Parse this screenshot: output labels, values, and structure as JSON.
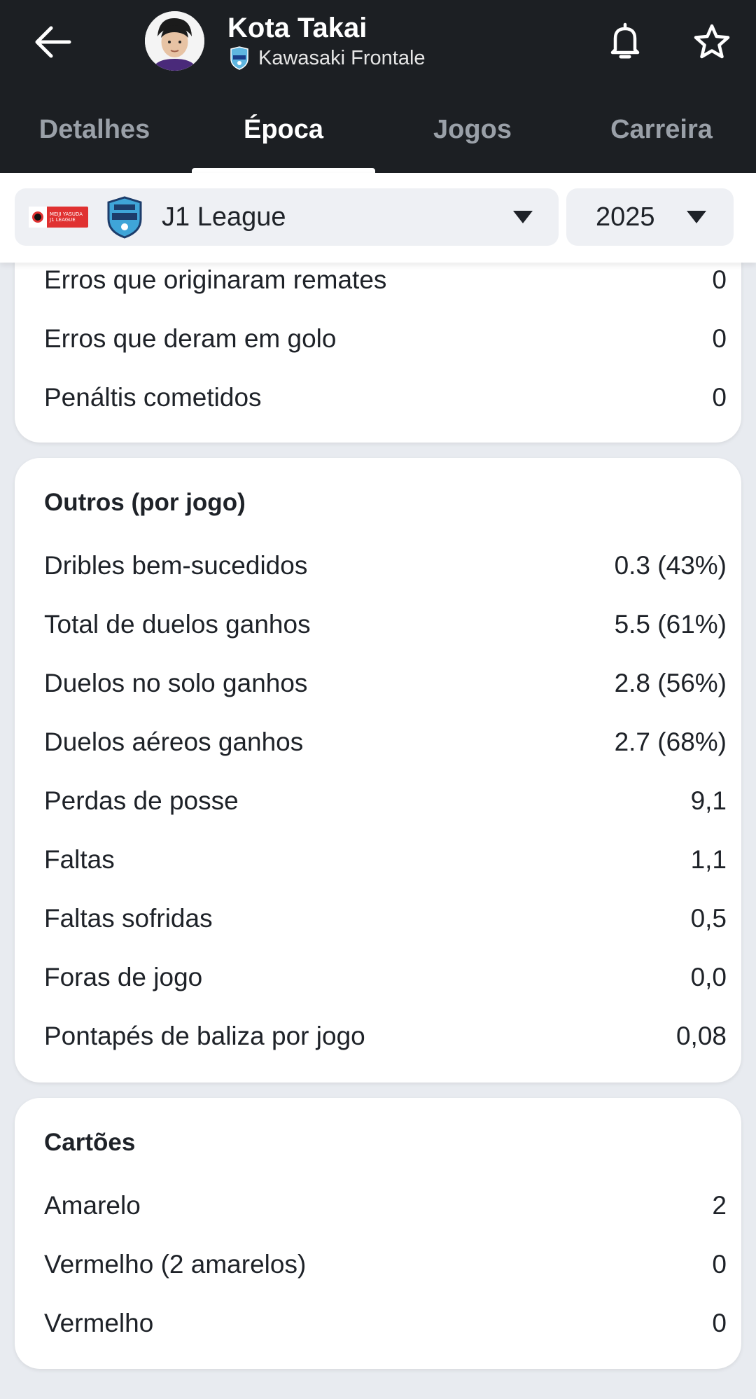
{
  "header": {
    "player_name": "Kota Takai",
    "team_name": "Kawasaki Frontale"
  },
  "tabs": [
    {
      "label": "Detalhes"
    },
    {
      "label": "Época"
    },
    {
      "label": "Jogos"
    },
    {
      "label": "Carreira"
    }
  ],
  "filters": {
    "league": "J1 League",
    "year": "2025"
  },
  "errors_card": {
    "rows": [
      {
        "label": "Erros que originaram remates",
        "value": "0"
      },
      {
        "label": "Erros que deram em golo",
        "value": "0"
      },
      {
        "label": "Penáltis cometidos",
        "value": "0"
      }
    ]
  },
  "other_card": {
    "title": "Outros (por jogo)",
    "rows": [
      {
        "label": "Dribles bem-sucedidos",
        "value": "0.3 (43%)"
      },
      {
        "label": "Total de duelos ganhos",
        "value": "5.5 (61%)"
      },
      {
        "label": "Duelos no solo ganhos",
        "value": "2.8 (56%)"
      },
      {
        "label": "Duelos aéreos ganhos",
        "value": "2.7 (68%)"
      },
      {
        "label": "Perdas de posse",
        "value": "9,1"
      },
      {
        "label": "Faltas",
        "value": "1,1"
      },
      {
        "label": "Faltas sofridas",
        "value": "0,5"
      },
      {
        "label": "Foras de jogo",
        "value": "0,0"
      },
      {
        "label": "Pontapés de baliza por jogo",
        "value": "0,08"
      }
    ]
  },
  "cards_card": {
    "title": "Cartões",
    "rows": [
      {
        "label": "Amarelo",
        "value": "2"
      },
      {
        "label": "Vermelho (2 amarelos)",
        "value": "0"
      },
      {
        "label": "Vermelho",
        "value": "0"
      }
    ]
  },
  "icons": {
    "back": "arrow-left-icon",
    "notifications": "bell-icon",
    "favorite": "star-icon",
    "dropdown": "caret-down-icon"
  },
  "colors": {
    "header_bg": "#1c1f23",
    "page_bg": "#e8ebf0",
    "card_bg": "#ffffff",
    "select_bg": "#eef0f4"
  }
}
